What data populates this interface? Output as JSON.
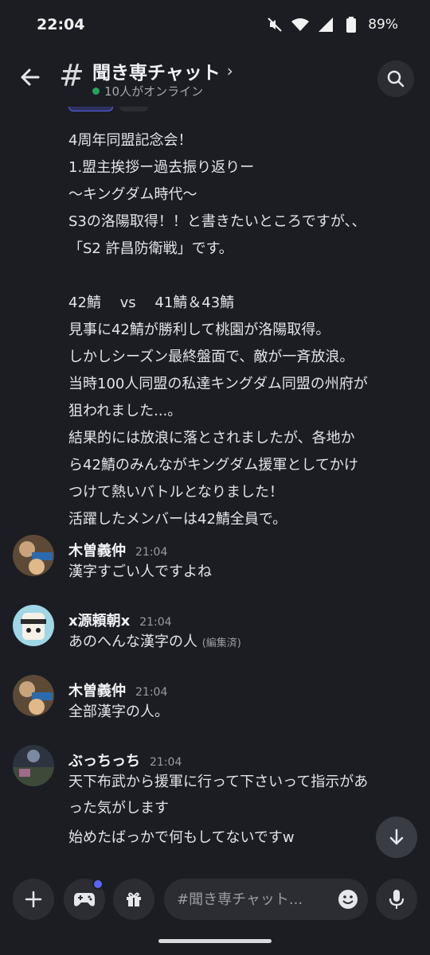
{
  "status_bar": {
    "time": "22:04",
    "battery": "89%",
    "icons": [
      "mute-icon",
      "wifi-icon",
      "signal-icon",
      "battery-icon"
    ]
  },
  "header": {
    "channel_name": "聞き専チャット",
    "online_text": "10人がオンライン",
    "icons": [
      "back-arrow-icon",
      "hash-icon",
      "chevron-right-icon",
      "search-icon"
    ]
  },
  "long_message": {
    "lines": [
      "4周年同盟記念会！",
      "1.盟主挨拶ー過去振り返りー",
      "〜キングダム時代〜",
      "S3の洛陽取得！！と書きたいところですが、、",
      "「S2 許昌防衛戦」です。",
      "",
      "42鯖　 vs　 41鯖＆43鯖",
      "見事に42鯖が勝利して桃園が洛陽取得。",
      "しかしシーズン最終盤面で、敵が一斉放浪。",
      "当時100人同盟の私達キングダム同盟の州府が",
      "狙われました...。",
      "結果的には放浪に落とされましたが、各地か",
      "ら42鯖のみんながキングダム援軍としてかけ",
      "つけて熱いバトルとなりました！",
      "活躍したメンバーは42鯖全員で。"
    ]
  },
  "messages": [
    {
      "author": "木曽義仲",
      "time": "21:04",
      "lines": [
        "漢字すごい人ですよね"
      ],
      "edited": ""
    },
    {
      "author": "x源頼朝x",
      "time": "21:04",
      "lines": [
        "あのへんな漢字の人"
      ],
      "edited": "(編集済)"
    },
    {
      "author": "木曽義仲",
      "time": "21:04",
      "lines": [
        "全部漢字の人。"
      ],
      "edited": ""
    },
    {
      "author": "ぶっちっち",
      "time": "21:04",
      "lines": [
        "天下布武から援軍に行って下さいって指示があ",
        "った気がします",
        "始めたばっかで何もしてないですw"
      ],
      "edited": ""
    }
  ],
  "composer": {
    "placeholder": "#聞き専チャット...",
    "icons": [
      "plus-icon",
      "gamepad-icon",
      "gift-icon",
      "emoji-icon",
      "microphone-icon",
      "arrow-down-icon"
    ],
    "accent": "#5865f2"
  },
  "colors": {
    "background": "#1c1d22",
    "online": "#23a55a",
    "accent": "#5865f2"
  }
}
